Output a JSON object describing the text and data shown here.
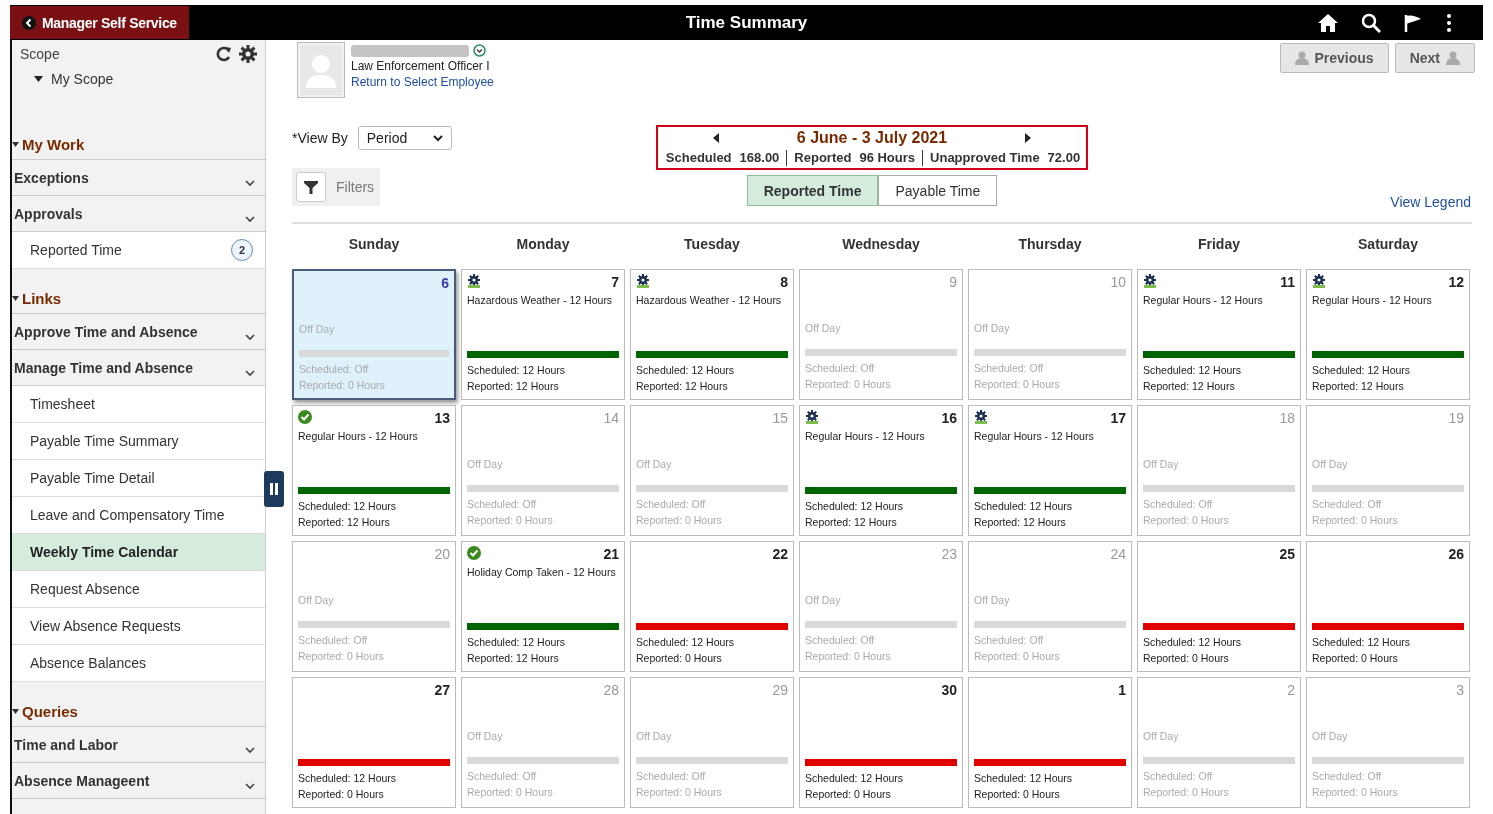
{
  "header": {
    "back_label": "Manager Self Service",
    "title": "Time Summary"
  },
  "sidebar": {
    "scope_label": "Scope",
    "scope_tree": {
      "label": "My Scope",
      "expanded": true
    },
    "items": [
      {
        "kind": "section",
        "label": "My Work"
      },
      {
        "kind": "group",
        "label": "Exceptions"
      },
      {
        "kind": "group",
        "label": "Approvals"
      },
      {
        "kind": "link",
        "label": "Reported Time",
        "badge": "2",
        "selected": false
      },
      {
        "kind": "section",
        "label": "Links"
      },
      {
        "kind": "group",
        "label": "Approve Time and Absence"
      },
      {
        "kind": "group",
        "label": "Manage Time and Absence"
      },
      {
        "kind": "link",
        "label": "Timesheet",
        "selected": false
      },
      {
        "kind": "link",
        "label": "Payable Time Summary",
        "selected": false
      },
      {
        "kind": "link",
        "label": "Payable Time Detail",
        "selected": false
      },
      {
        "kind": "link",
        "label": "Leave and Compensatory Time",
        "selected": false
      },
      {
        "kind": "link",
        "label": "Weekly Time Calendar",
        "selected": true
      },
      {
        "kind": "link",
        "label": "Request Absence",
        "selected": false
      },
      {
        "kind": "link",
        "label": "View Absence Requests",
        "selected": false
      },
      {
        "kind": "link",
        "label": "Absence Balances",
        "selected": false
      },
      {
        "kind": "section",
        "label": "Queries"
      },
      {
        "kind": "group",
        "label": "Time and Labor"
      },
      {
        "kind": "group",
        "label": "Absence Manageent"
      }
    ]
  },
  "employee": {
    "job_title": "Law Enforcement Officer I",
    "return_link": "Return to Select Employee"
  },
  "nav_buttons": [
    "Previous",
    "Next"
  ],
  "view_by": {
    "label": "*View By",
    "value": "Period"
  },
  "period": {
    "title": "6 June - 3 July 2021",
    "summary": [
      {
        "label": "Scheduled",
        "value": "168.00"
      },
      {
        "label": "Reported",
        "value": "96 Hours"
      },
      {
        "label": "Unapproved Time",
        "value": "72.00"
      }
    ]
  },
  "filters_label": "Filters",
  "toggle": [
    {
      "label": "Reported Time",
      "selected": true
    },
    {
      "label": "Payable Time",
      "selected": false
    }
  ],
  "legend_link": "View Legend",
  "weekdays": [
    "Sunday",
    "Monday",
    "Tuesday",
    "Wednesday",
    "Thursday",
    "Friday",
    "Saturday"
  ],
  "days": [
    {
      "day": "6",
      "kind": "none",
      "off": true,
      "selected": true,
      "entry": "Off Day",
      "color": "#d9d9d9",
      "scheduled": "Scheduled: Off",
      "reported": "Reported: 0 Hours"
    },
    {
      "day": "7",
      "kind": "gear",
      "off": false,
      "selected": false,
      "entry": "Hazardous Weather - 12 Hours",
      "color": "#006400",
      "scheduled": "Scheduled: 12 Hours",
      "reported": "Reported: 12 Hours"
    },
    {
      "day": "8",
      "kind": "gear",
      "off": false,
      "selected": false,
      "entry": "Hazardous Weather - 12 Hours",
      "color": "#006400",
      "scheduled": "Scheduled: 12 Hours",
      "reported": "Reported: 12 Hours"
    },
    {
      "day": "9",
      "kind": "none",
      "off": true,
      "selected": false,
      "entry": "Off Day",
      "color": "#d9d9d9",
      "scheduled": "Scheduled: Off",
      "reported": "Reported: 0 Hours"
    },
    {
      "day": "10",
      "kind": "none",
      "off": true,
      "selected": false,
      "entry": "Off Day",
      "color": "#d9d9d9",
      "scheduled": "Scheduled: Off",
      "reported": "Reported: 0 Hours"
    },
    {
      "day": "11",
      "kind": "gear",
      "off": false,
      "selected": false,
      "entry": "Regular Hours - 12 Hours",
      "color": "#006400",
      "scheduled": "Scheduled: 12 Hours",
      "reported": "Reported: 12 Hours"
    },
    {
      "day": "12",
      "kind": "gear",
      "off": false,
      "selected": false,
      "entry": "Regular Hours - 12 Hours",
      "color": "#006400",
      "scheduled": "Scheduled: 12 Hours",
      "reported": "Reported: 12 Hours"
    },
    {
      "day": "13",
      "kind": "check",
      "off": false,
      "selected": false,
      "entry": "Regular Hours - 12 Hours",
      "color": "#006400",
      "scheduled": "Scheduled: 12 Hours",
      "reported": "Reported: 12 Hours"
    },
    {
      "day": "14",
      "kind": "none",
      "off": true,
      "selected": false,
      "entry": "Off Day",
      "color": "#d9d9d9",
      "scheduled": "Scheduled: Off",
      "reported": "Reported: 0 Hours"
    },
    {
      "day": "15",
      "kind": "none",
      "off": true,
      "selected": false,
      "entry": "Off Day",
      "color": "#d9d9d9",
      "scheduled": "Scheduled: Off",
      "reported": "Reported: 0 Hours"
    },
    {
      "day": "16",
      "kind": "gear",
      "off": false,
      "selected": false,
      "entry": "Regular Hours - 12 Hours",
      "color": "#006400",
      "scheduled": "Scheduled: 12 Hours",
      "reported": "Reported: 12 Hours"
    },
    {
      "day": "17",
      "kind": "gear",
      "off": false,
      "selected": false,
      "entry": "Regular Hours - 12 Hours",
      "color": "#006400",
      "scheduled": "Scheduled: 12 Hours",
      "reported": "Reported: 12 Hours"
    },
    {
      "day": "18",
      "kind": "none",
      "off": true,
      "selected": false,
      "entry": "Off Day",
      "color": "#d9d9d9",
      "scheduled": "Scheduled: Off",
      "reported": "Reported: 0 Hours"
    },
    {
      "day": "19",
      "kind": "none",
      "off": true,
      "selected": false,
      "entry": "Off Day",
      "color": "#d9d9d9",
      "scheduled": "Scheduled: Off",
      "reported": "Reported: 0 Hours"
    },
    {
      "day": "20",
      "kind": "none",
      "off": true,
      "selected": false,
      "entry": "Off Day",
      "color": "#d9d9d9",
      "scheduled": "Scheduled: Off",
      "reported": "Reported: 0 Hours"
    },
    {
      "day": "21",
      "kind": "check",
      "off": false,
      "selected": false,
      "entry": "Holiday Comp Taken - 12 Hours",
      "color": "#006400",
      "scheduled": "Scheduled: 12 Hours",
      "reported": "Reported: 12 Hours"
    },
    {
      "day": "22",
      "kind": "none",
      "off": false,
      "selected": false,
      "color": "#e00000",
      "scheduled": "Scheduled: 12 Hours",
      "reported": "Reported: 0 Hours"
    },
    {
      "day": "23",
      "kind": "none",
      "off": true,
      "selected": false,
      "entry": "Off Day",
      "color": "#d9d9d9",
      "scheduled": "Scheduled: Off",
      "reported": "Reported: 0 Hours"
    },
    {
      "day": "24",
      "kind": "none",
      "off": true,
      "selected": false,
      "entry": "Off Day",
      "color": "#d9d9d9",
      "scheduled": "Scheduled: Off",
      "reported": "Reported: 0 Hours"
    },
    {
      "day": "25",
      "kind": "none",
      "off": false,
      "selected": false,
      "color": "#e00000",
      "scheduled": "Scheduled: 12 Hours",
      "reported": "Reported: 0 Hours"
    },
    {
      "day": "26",
      "kind": "none",
      "off": false,
      "selected": false,
      "color": "#e00000",
      "scheduled": "Scheduled: 12 Hours",
      "reported": "Reported: 0 Hours"
    },
    {
      "day": "27",
      "kind": "none",
      "off": false,
      "selected": false,
      "color": "#e00000",
      "scheduled": "Scheduled: 12 Hours",
      "reported": "Reported: 0 Hours"
    },
    {
      "day": "28",
      "kind": "none",
      "off": true,
      "selected": false,
      "entry": "Off Day",
      "color": "#d9d9d9",
      "scheduled": "Scheduled: Off",
      "reported": "Reported: 0 Hours"
    },
    {
      "day": "29",
      "kind": "none",
      "off": true,
      "selected": false,
      "entry": "Off Day",
      "color": "#d9d9d9",
      "scheduled": "Scheduled: Off",
      "reported": "Reported: 0 Hours"
    },
    {
      "day": "30",
      "kind": "none",
      "off": false,
      "selected": false,
      "color": "#e00000",
      "scheduled": "Scheduled: 12 Hours",
      "reported": "Reported: 0 Hours"
    },
    {
      "day": "1",
      "kind": "none",
      "off": false,
      "selected": false,
      "color": "#e00000",
      "scheduled": "Scheduled: 12 Hours",
      "reported": "Reported: 0 Hours"
    },
    {
      "day": "2",
      "kind": "none",
      "off": true,
      "selected": false,
      "entry": "Off Day",
      "color": "#d9d9d9",
      "scheduled": "Scheduled: Off",
      "reported": "Reported: 0 Hours"
    },
    {
      "day": "3",
      "kind": "none",
      "off": true,
      "selected": false,
      "entry": "Off Day",
      "color": "#d9d9d9",
      "scheduled": "Scheduled: Off",
      "reported": "Reported: 0 Hours"
    }
  ]
}
